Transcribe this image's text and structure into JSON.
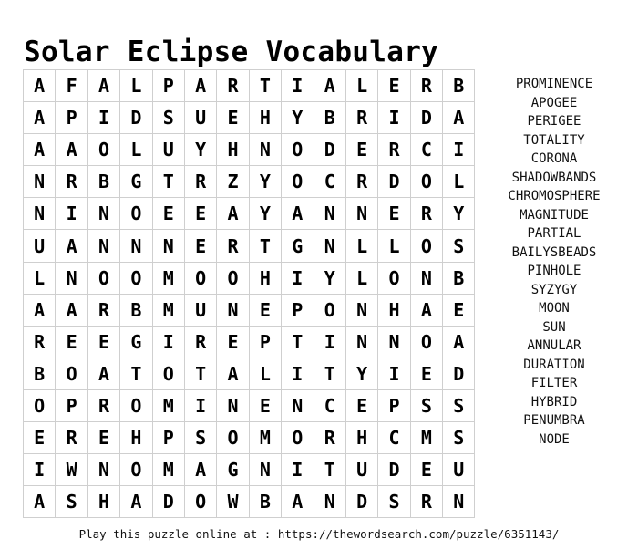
{
  "title": "Solar Eclipse Vocabulary",
  "grid": [
    [
      "A",
      "F",
      "A",
      "L",
      "P",
      "A",
      "R",
      "T",
      "I",
      "A",
      "L",
      "E",
      "R",
      "B"
    ],
    [
      "A",
      "P",
      "I",
      "D",
      "S",
      "U",
      "E",
      "H",
      "Y",
      "B",
      "R",
      "I",
      "D",
      "A"
    ],
    [
      "A",
      "A",
      "O",
      "L",
      "U",
      "Y",
      "H",
      "N",
      "O",
      "D",
      "E",
      "R",
      "C",
      "I"
    ],
    [
      "N",
      "R",
      "B",
      "G",
      "T",
      "R",
      "Z",
      "Y",
      "O",
      "C",
      "R",
      "D",
      "O",
      "L"
    ],
    [
      "N",
      "I",
      "N",
      "O",
      "E",
      "E",
      "A",
      "Y",
      "A",
      "N",
      "N",
      "E",
      "R",
      "Y"
    ],
    [
      "U",
      "A",
      "N",
      "N",
      "N",
      "E",
      "R",
      "T",
      "G",
      "N",
      "L",
      "L",
      "O",
      "S"
    ],
    [
      "L",
      "N",
      "O",
      "O",
      "M",
      "O",
      "O",
      "H",
      "I",
      "Y",
      "L",
      "O",
      "N",
      "B"
    ],
    [
      "A",
      "A",
      "R",
      "B",
      "M",
      "U",
      "N",
      "E",
      "P",
      "O",
      "N",
      "H",
      "A",
      "E"
    ],
    [
      "R",
      "E",
      "E",
      "G",
      "I",
      "R",
      "E",
      "P",
      "T",
      "I",
      "N",
      "N",
      "O",
      "A"
    ],
    [
      "B",
      "O",
      "A",
      "T",
      "O",
      "T",
      "A",
      "L",
      "I",
      "T",
      "Y",
      "I",
      "E",
      "D"
    ],
    [
      "O",
      "P",
      "R",
      "O",
      "M",
      "I",
      "N",
      "E",
      "N",
      "C",
      "E",
      "P",
      "S",
      "S"
    ],
    [
      "E",
      "R",
      "E",
      "H",
      "P",
      "S",
      "O",
      "M",
      "O",
      "R",
      "H",
      "C",
      "M",
      "S"
    ],
    [
      "I",
      "W",
      "N",
      "O",
      "M",
      "A",
      "G",
      "N",
      "I",
      "T",
      "U",
      "D",
      "E",
      "U"
    ],
    [
      "A",
      "S",
      "H",
      "A",
      "D",
      "O",
      "W",
      "B",
      "A",
      "N",
      "D",
      "S",
      "R",
      "N"
    ]
  ],
  "words": [
    "PROMINENCE",
    "APOGEE",
    "PERIGEE",
    "TOTALITY",
    "CORONA",
    "SHADOWBANDS",
    "CHROMOSPHERE",
    "MAGNITUDE",
    "PARTIAL",
    "BAILYSBEADS",
    "PINHOLE",
    "SYZYGY",
    "MOON",
    "SUN",
    "ANNULAR",
    "DURATION",
    "FILTER",
    "HYBRID",
    "PENUMBRA",
    "NODE"
  ],
  "footer": "Play this puzzle online at : https://thewordsearch.com/puzzle/6351143/"
}
